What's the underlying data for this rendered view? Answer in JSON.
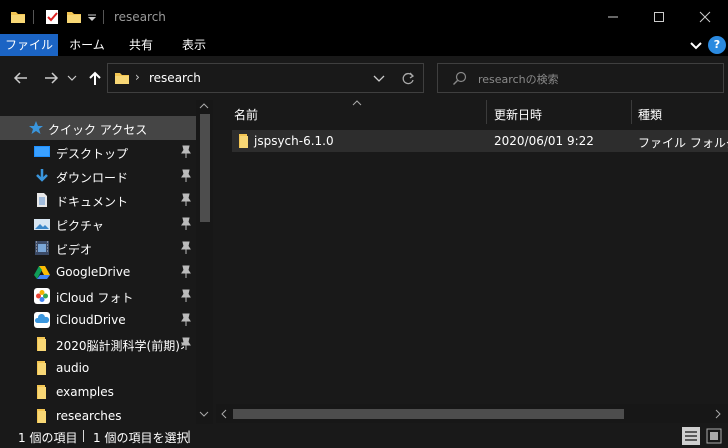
{
  "window": {
    "title": "research"
  },
  "ribbon": {
    "tabs": [
      "ファイル",
      "ホーム",
      "共有",
      "表示"
    ],
    "help_label": "?"
  },
  "navigation": {
    "breadcrumb_separator": "›",
    "current_folder": "research",
    "search_placeholder": "researchの検索"
  },
  "sidebar": {
    "items": [
      {
        "label": "クイック アクセス",
        "icon": "star-icon",
        "pinned": false
      },
      {
        "label": "デスクトップ",
        "icon": "desktop-icon",
        "pinned": true
      },
      {
        "label": "ダウンロード",
        "icon": "download-icon",
        "pinned": true
      },
      {
        "label": "ドキュメント",
        "icon": "document-icon",
        "pinned": true
      },
      {
        "label": "ピクチャ",
        "icon": "pictures-icon",
        "pinned": true
      },
      {
        "label": "ビデオ",
        "icon": "video-icon",
        "pinned": true
      },
      {
        "label": "GoogleDrive",
        "icon": "google-drive-icon",
        "pinned": true
      },
      {
        "label": "iCloud フォト",
        "icon": "icloud-photos-icon",
        "pinned": true
      },
      {
        "label": "iCloudDrive",
        "icon": "icloud-drive-icon",
        "pinned": true
      },
      {
        "label": "2020脳計測科学(前期)オ",
        "icon": "folder-icon",
        "pinned": true
      },
      {
        "label": "audio",
        "icon": "folder-icon",
        "pinned": false
      },
      {
        "label": "examples",
        "icon": "folder-icon",
        "pinned": false
      },
      {
        "label": "researches",
        "icon": "folder-icon",
        "pinned": false
      }
    ]
  },
  "file_list": {
    "columns": [
      "名前",
      "更新日時",
      "種類"
    ],
    "rows": [
      {
        "name": "jspsych-6.1.0",
        "modified": "2020/06/01 9:22",
        "type": "ファイル フォルダー"
      }
    ]
  },
  "status": {
    "item_count": "1 個の項目",
    "selected_count": "1 個の項目を選択",
    "trailing": "|"
  },
  "colors": {
    "accent": "#1b64c4",
    "folder": "#f3c552",
    "background": "#191919",
    "titlebar": "#000000"
  }
}
